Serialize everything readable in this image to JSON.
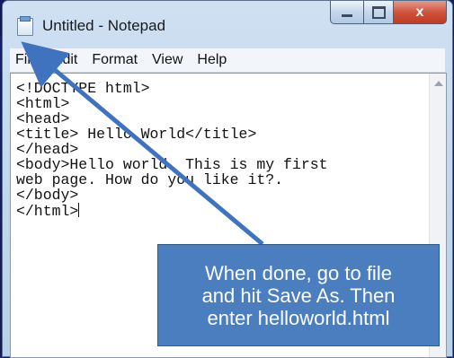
{
  "window": {
    "title": "Untitled - Notepad",
    "close_glyph": "x",
    "icons": {
      "app": "notepad-icon",
      "minimize": "minimize-icon",
      "maximize": "maximize-icon",
      "close": "close-icon"
    }
  },
  "menubar": {
    "items": [
      {
        "label": "File"
      },
      {
        "label": "Edit"
      },
      {
        "label": "Format"
      },
      {
        "label": "View"
      },
      {
        "label": "Help"
      }
    ]
  },
  "editor": {
    "content": "<!DOCTYPE html>\n<html>\n<head>\n<title> Hello World</title>\n</head>\n<body>Hello world. This is my first\nweb page. How do you like it?.\n</body>\n</html>"
  },
  "callout": {
    "text": "When done, go to file\nand hit Save As. Then\nenter helloworld.html",
    "color": "#4a7ebf"
  },
  "arrow": {
    "color": "#3f73bf"
  }
}
